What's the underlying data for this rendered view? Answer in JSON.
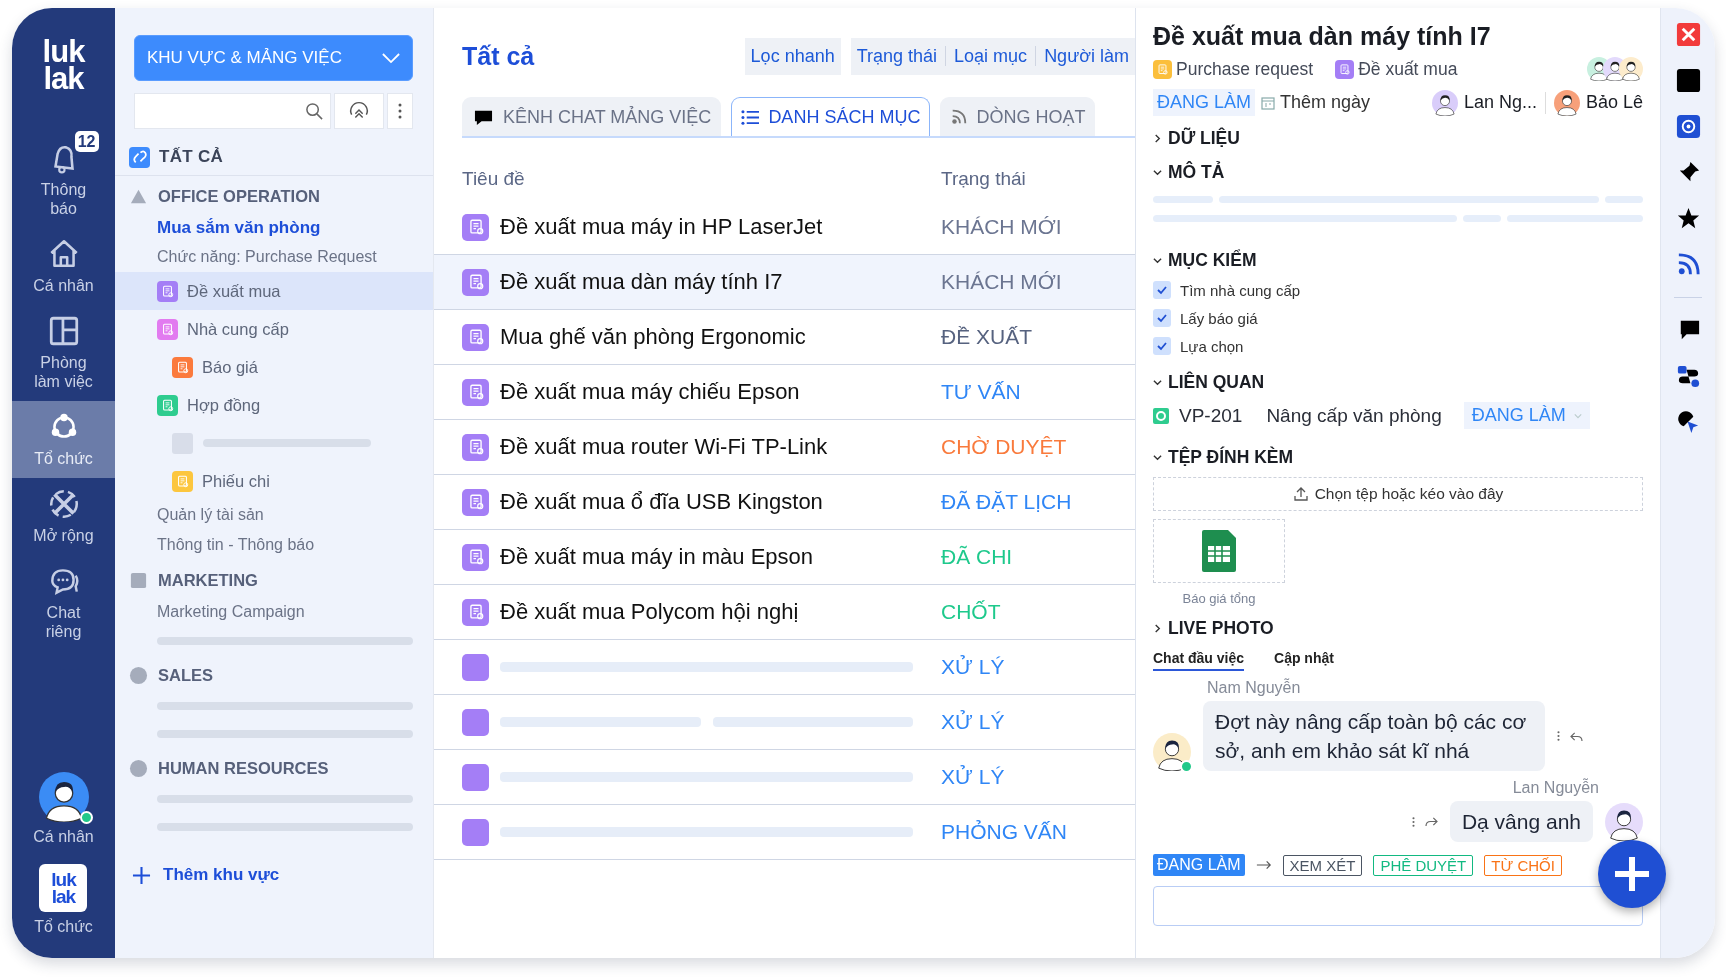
{
  "nav": {
    "logo": [
      "luk",
      "lak"
    ],
    "items": [
      {
        "label": "Thông báo",
        "badge": "12",
        "selected": false
      },
      {
        "label": "Cá nhân",
        "selected": false
      },
      {
        "label": "Phòng làm việc",
        "selected": false
      },
      {
        "label": "Tổ chức",
        "selected": true
      },
      {
        "label": "Mở rộng",
        "selected": false
      },
      {
        "label": "Chat riêng",
        "selected": false
      }
    ],
    "profile": {
      "label": "Cá nhân",
      "online": true
    },
    "org": {
      "logo": [
        "luk",
        "lak"
      ],
      "label": "Tổ chức"
    }
  },
  "sidebar": {
    "dropdown": "KHU VỰC & MẢNG VIỆC",
    "all": "TẤT CẢ",
    "groups": [
      {
        "name": "OFFICE OPERATION",
        "children": [
          {
            "kind": "project",
            "label": "Mua sắm văn phòng"
          },
          {
            "kind": "caption",
            "label": "Chức năng: Purchase Request"
          },
          {
            "kind": "item",
            "label": "Đề xuất mua",
            "color": "#a47ef6",
            "selected": true
          },
          {
            "kind": "item",
            "label": "Nhà cung cấp",
            "color": "#e27bf0",
            "selected": false,
            "children": [
              {
                "kind": "item",
                "label": "Báo giá",
                "color": "#fb7a3d",
                "selected": false
              }
            ]
          },
          {
            "kind": "item",
            "label": "Hợp đồng",
            "color": "#2ecc8f",
            "selected": false,
            "children": [
              {
                "kind": "placeholder_item"
              },
              {
                "kind": "item",
                "label": "Phiếu chi",
                "color": "#fcc63e",
                "selected": false
              }
            ]
          },
          {
            "kind": "link",
            "label": "Quản lý tài sản"
          },
          {
            "kind": "link",
            "label": "Thông tin - Thông báo"
          }
        ]
      },
      {
        "name": "MARKETING",
        "children": [
          {
            "kind": "link",
            "label": "Marketing Campaign"
          },
          {
            "kind": "placeholder"
          }
        ]
      },
      {
        "name": "SALES",
        "children": [
          {
            "kind": "placeholder"
          },
          {
            "kind": "placeholder"
          }
        ]
      },
      {
        "name": "HUMAN RESOURCES",
        "children": [
          {
            "kind": "placeholder"
          },
          {
            "kind": "placeholder"
          }
        ]
      }
    ],
    "add": "Thêm khu vực"
  },
  "main": {
    "title": "Tất cả",
    "quick_filter": "Lọc nhanh",
    "filters": [
      "Trạng thái",
      "Loại mục",
      "Người làm"
    ],
    "tabs": [
      {
        "label": "KÊNH CHAT MẢNG VIỆC",
        "selected": false
      },
      {
        "label": "DANH SÁCH MỤC",
        "selected": true
      },
      {
        "label": "DÒNG HOẠT",
        "selected": false
      }
    ],
    "table": {
      "columns": [
        "Tiêu đề",
        "Trạng thái"
      ],
      "rows": [
        {
          "kind": "item",
          "title": "Đề xuất mua máy in HP LaserJet",
          "status": "KHÁCH MỚI",
          "color": "#6b7591",
          "selected": false
        },
        {
          "kind": "item",
          "title": "Đề xuất mua dàn máy tính I7",
          "status": "KHÁCH MỚI",
          "color": "#6b7591",
          "selected": true
        },
        {
          "kind": "item",
          "title": "Mua ghế văn phòng Ergonomic",
          "status": "ĐỀ XUẤT",
          "color": "#56627f",
          "selected": false
        },
        {
          "kind": "item",
          "title": "Đề xuất mua máy chiếu Epson",
          "status": "TƯ VẤN",
          "color": "#2f86f6",
          "selected": false
        },
        {
          "kind": "item",
          "title": "Đề xuất mua router Wi-Fi TP-Link",
          "status": "CHỜ DUYỆT",
          "color": "#f97a3c",
          "selected": false
        },
        {
          "kind": "item",
          "title": "Đề xuất mua ổ đĩa USB Kingston",
          "status": "ĐÃ ĐẶT LỊCH",
          "color": "#2f86f6",
          "selected": false
        },
        {
          "kind": "item",
          "title": "Đề xuất mua máy in màu Epson",
          "status": "ĐÃ CHI",
          "color": "#1ec98c",
          "selected": false
        },
        {
          "kind": "item",
          "title": "Đề xuất mua Polycom hội nghị",
          "status": "CHỐT",
          "color": "#1ec98c",
          "selected": false
        },
        {
          "kind": "placeholder",
          "status": "XỬ LÝ",
          "color": "#2f86f6",
          "selected": false
        },
        {
          "kind": "placeholder_split",
          "status": "XỬ LÝ",
          "color": "#2f86f6",
          "selected": false
        },
        {
          "kind": "placeholder",
          "status": "XỬ LÝ",
          "color": "#2f86f6",
          "selected": false
        },
        {
          "kind": "placeholder",
          "status": "PHỎNG VẤN",
          "color": "#2f86f6",
          "selected": false
        }
      ]
    }
  },
  "detail": {
    "title": "Đề xuất mua dàn máy tính I7",
    "tags": [
      {
        "label": "Purchase request",
        "color": "#fbbf3c"
      },
      {
        "label": "Đề xuất mua",
        "color": "#a47ef6"
      }
    ],
    "status": "ĐANG LÀM",
    "date": "Thêm ngày",
    "assignees": [
      "Lan Ng...",
      "Bảo Lê"
    ],
    "sections": [
      {
        "title": "DỮ LIỆU",
        "expanded": false
      },
      {
        "kind": "description",
        "title": "MÔ TẢ",
        "expanded": true
      },
      {
        "kind": "checklist",
        "title": "MỤC KIỂM",
        "expanded": true,
        "items": [
          {
            "label": "Tìm nhà cung cấp",
            "checked": true
          },
          {
            "label": "Lấy báo giá",
            "checked": true
          },
          {
            "label": "Lựa chọn",
            "checked": true
          }
        ]
      },
      {
        "kind": "related",
        "title": "LIÊN QUAN",
        "expanded": true,
        "items": [
          {
            "code": "VP-201",
            "name": "Nâng cấp văn phòng",
            "status": "ĐANG LÀM"
          }
        ]
      },
      {
        "kind": "attachments",
        "title": "TỆP ĐÍNH KÈM",
        "expanded": true,
        "upload": "Chọn tệp hoặc kéo vào đây",
        "files": [
          {
            "name": "Báo giá tổng"
          }
        ]
      },
      {
        "title": "LIVE PHOTO",
        "expanded": false
      }
    ],
    "chat": {
      "tabs": [
        {
          "label": "Chat đầu việc",
          "selected": true
        },
        {
          "label": "Cập nhật",
          "selected": false
        }
      ],
      "messages": [
        {
          "author": "Nam Nguyễn",
          "text": "Đợt này nâng cấp toàn bộ các cơ sở, anh em khảo sát kĩ nhá",
          "mine": false,
          "online": true
        },
        {
          "author": "Lan Nguyễn",
          "text": "Dạ vâng anh",
          "mine": true,
          "online": false
        }
      ]
    },
    "workflow": {
      "current": "ĐANG LÀM",
      "actions": [
        {
          "label": "XEM XÉT",
          "color": "#4b5563"
        },
        {
          "label": "PHÊ DUYỆT",
          "color": "#12b981"
        },
        {
          "label": "TỪ CHỐI",
          "color": "#f97316"
        }
      ]
    }
  }
}
